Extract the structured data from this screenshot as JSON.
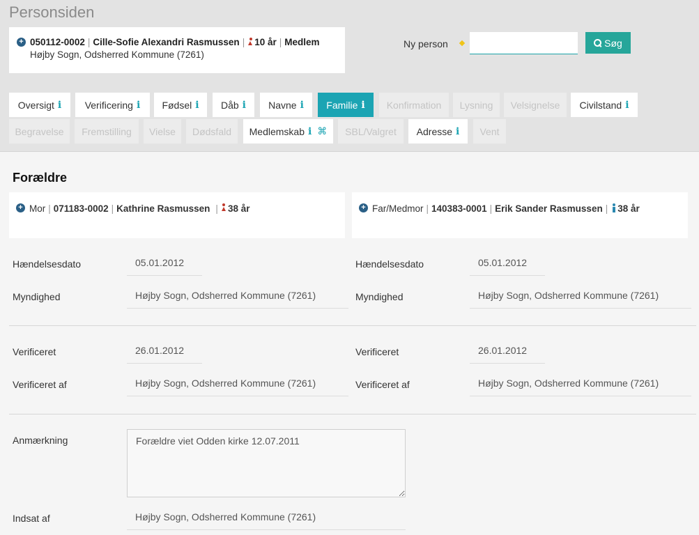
{
  "page_title": "Personsiden",
  "person": {
    "id": "050112-0002",
    "name": "Cille-Sofie Alexandri Rasmussen",
    "gender_icon": "female-icon",
    "age": "10 år",
    "status": "Medlem",
    "location": "Højby Sogn, Odsherred Kommune (7261)"
  },
  "search": {
    "label": "Ny person",
    "placeholder": "",
    "button_label": "Søg"
  },
  "tabs_row1": [
    {
      "label": "Oversigt",
      "info": "i"
    },
    {
      "label": "Verificering",
      "info": "i"
    },
    {
      "label": "Fødsel",
      "info": "i"
    },
    {
      "label": "Dåb",
      "info": "i"
    },
    {
      "label": "Navne",
      "info": "i"
    },
    {
      "label": "Familie",
      "info": "i",
      "state": "active"
    },
    {
      "label": "Konfirmation",
      "state": "disabled"
    },
    {
      "label": "Lysning",
      "state": "disabled"
    },
    {
      "label": "Velsignelse",
      "state": "disabled"
    },
    {
      "label": "Civilstand",
      "info": "i"
    }
  ],
  "tabs_row2": [
    {
      "label": "Begravelse",
      "state": "disabled"
    },
    {
      "label": "Fremstilling",
      "state": "disabled"
    },
    {
      "label": "Vielse",
      "state": "disabled"
    },
    {
      "label": "Dødsfald",
      "state": "disabled"
    },
    {
      "label": "Medlemskab",
      "info": "i",
      "extra": "⌘"
    },
    {
      "label": "SBL/Valgret",
      "state": "disabled"
    },
    {
      "label": "Adresse",
      "info": "i"
    },
    {
      "label": "Vent",
      "state": "disabled"
    }
  ],
  "section_title": "Forældre",
  "mother": {
    "role": "Mor",
    "id": "071183-0002",
    "name": "Kathrine Rasmussen",
    "age": "38 år"
  },
  "father": {
    "role": "Far/Medmor",
    "id": "140383-0001",
    "name": "Erik Sander Rasmussen",
    "age": "38 år"
  },
  "fields": {
    "event_date_label": "Hændelsesdato",
    "authority_label": "Myndighed",
    "verified_label": "Verificeret",
    "verified_by_label": "Verificeret af",
    "left": {
      "event_date": "05.01.2012",
      "authority": "Højby Sogn, Odsherred Kommune (7261)",
      "verified": "26.01.2012",
      "verified_by": "Højby Sogn, Odsherred Kommune (7261)"
    },
    "right": {
      "event_date": "05.01.2012",
      "authority": "Højby Sogn, Odsherred Kommune (7261)",
      "verified": "26.01.2012",
      "verified_by": "Højby Sogn, Odsherred Kommune (7261)"
    }
  },
  "remark": {
    "label": "Anmærkning",
    "value": "Forældre viet Odden kirke 12.07.2011"
  },
  "inserted_by": {
    "label": "Indsat af",
    "value": "Højby Sogn, Odsherred Kommune (7261)"
  },
  "colors": {
    "accent": "#1ba4b3",
    "search_button": "#26a69a",
    "female": "#c0392b",
    "male": "#2a88b0"
  }
}
